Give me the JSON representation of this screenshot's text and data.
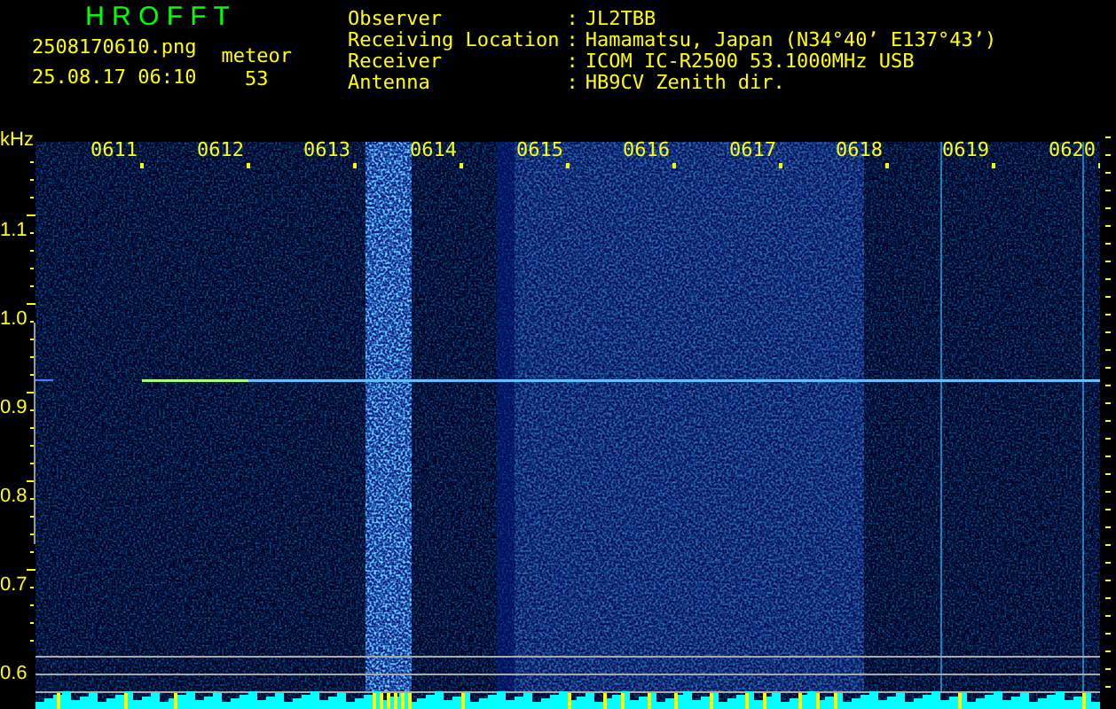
{
  "header": {
    "title": "H R O F F T",
    "filename": "2508170610.png",
    "datetime": "25.08.17 06:10",
    "event_label": "meteor",
    "event_count": "53"
  },
  "station": [
    {
      "label": "Observer",
      "separator": ":",
      "value": "JL2TBB"
    },
    {
      "label": "Receiving Location",
      "separator": ":",
      "value": "Hamamatsu, Japan (N34°40’ E137°43’)"
    },
    {
      "label": "Receiver",
      "separator": ":",
      "value": "ICOM IC-R2500 53.1000MHz USB"
    },
    {
      "label": "Antenna",
      "separator": ":",
      "value": "HB9CV Zenith dir."
    }
  ],
  "spectrogram": {
    "frequency_unit": "kHz",
    "time_labels": [
      "0611",
      "0612",
      "0613",
      "0614",
      "0615",
      "0616",
      "0617",
      "0618",
      "0619",
      "0620"
    ],
    "frequency_labels": [
      "1.1",
      "1.0",
      "0.9",
      "0.8",
      "0.7",
      "0.6"
    ]
  }
}
